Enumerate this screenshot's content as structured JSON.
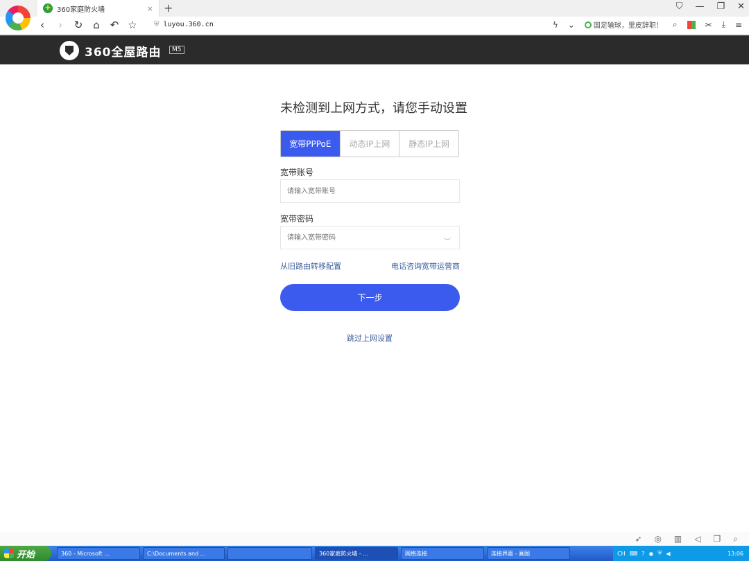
{
  "browser": {
    "tab_title": "360家庭防火墙",
    "tab_close": "×",
    "new_tab": "+",
    "url": "luyou.360.cn",
    "news_text": "国足输球，里皮辞职！",
    "icons": {
      "back": "back-arrow-icon",
      "forward": "forward-arrow-icon",
      "refresh": "refresh-icon",
      "home": "home-icon",
      "undo": "undo-icon",
      "star": "star-icon"
    }
  },
  "router": {
    "brand": "360全屋路由",
    "model": "M5"
  },
  "setup": {
    "title": "未检测到上网方式，请您手动设置",
    "tabs": [
      {
        "label": "宽带PPPoE",
        "active": true
      },
      {
        "label": "动态IP上网",
        "active": false
      },
      {
        "label": "静态IP上网",
        "active": false
      }
    ],
    "account_label": "宽带账号",
    "account_placeholder": "请输入宽带账号",
    "password_label": "宽带密码",
    "password_placeholder": "请输入宽带密码",
    "migrate_link": "从旧路由转移配置",
    "consult_link": "电话咨询宽带运营商",
    "next_button": "下一步",
    "skip_link": "跳过上网设置"
  },
  "taskbar": {
    "start": "开始",
    "tasks": [
      {
        "label": "360 - Microsoft ..."
      },
      {
        "label": "C:\\Documents and ..."
      },
      {
        "label": ""
      },
      {
        "label": "360家庭防火墙 - ..."
      },
      {
        "label": "网络连接"
      },
      {
        "label": "连接界面 - 画图"
      }
    ],
    "tray_lang": "CH",
    "clock": "13:06"
  },
  "colors": {
    "accent": "#3b5bef",
    "header_bg": "#2b2b2b",
    "link": "#3a5c9e"
  }
}
